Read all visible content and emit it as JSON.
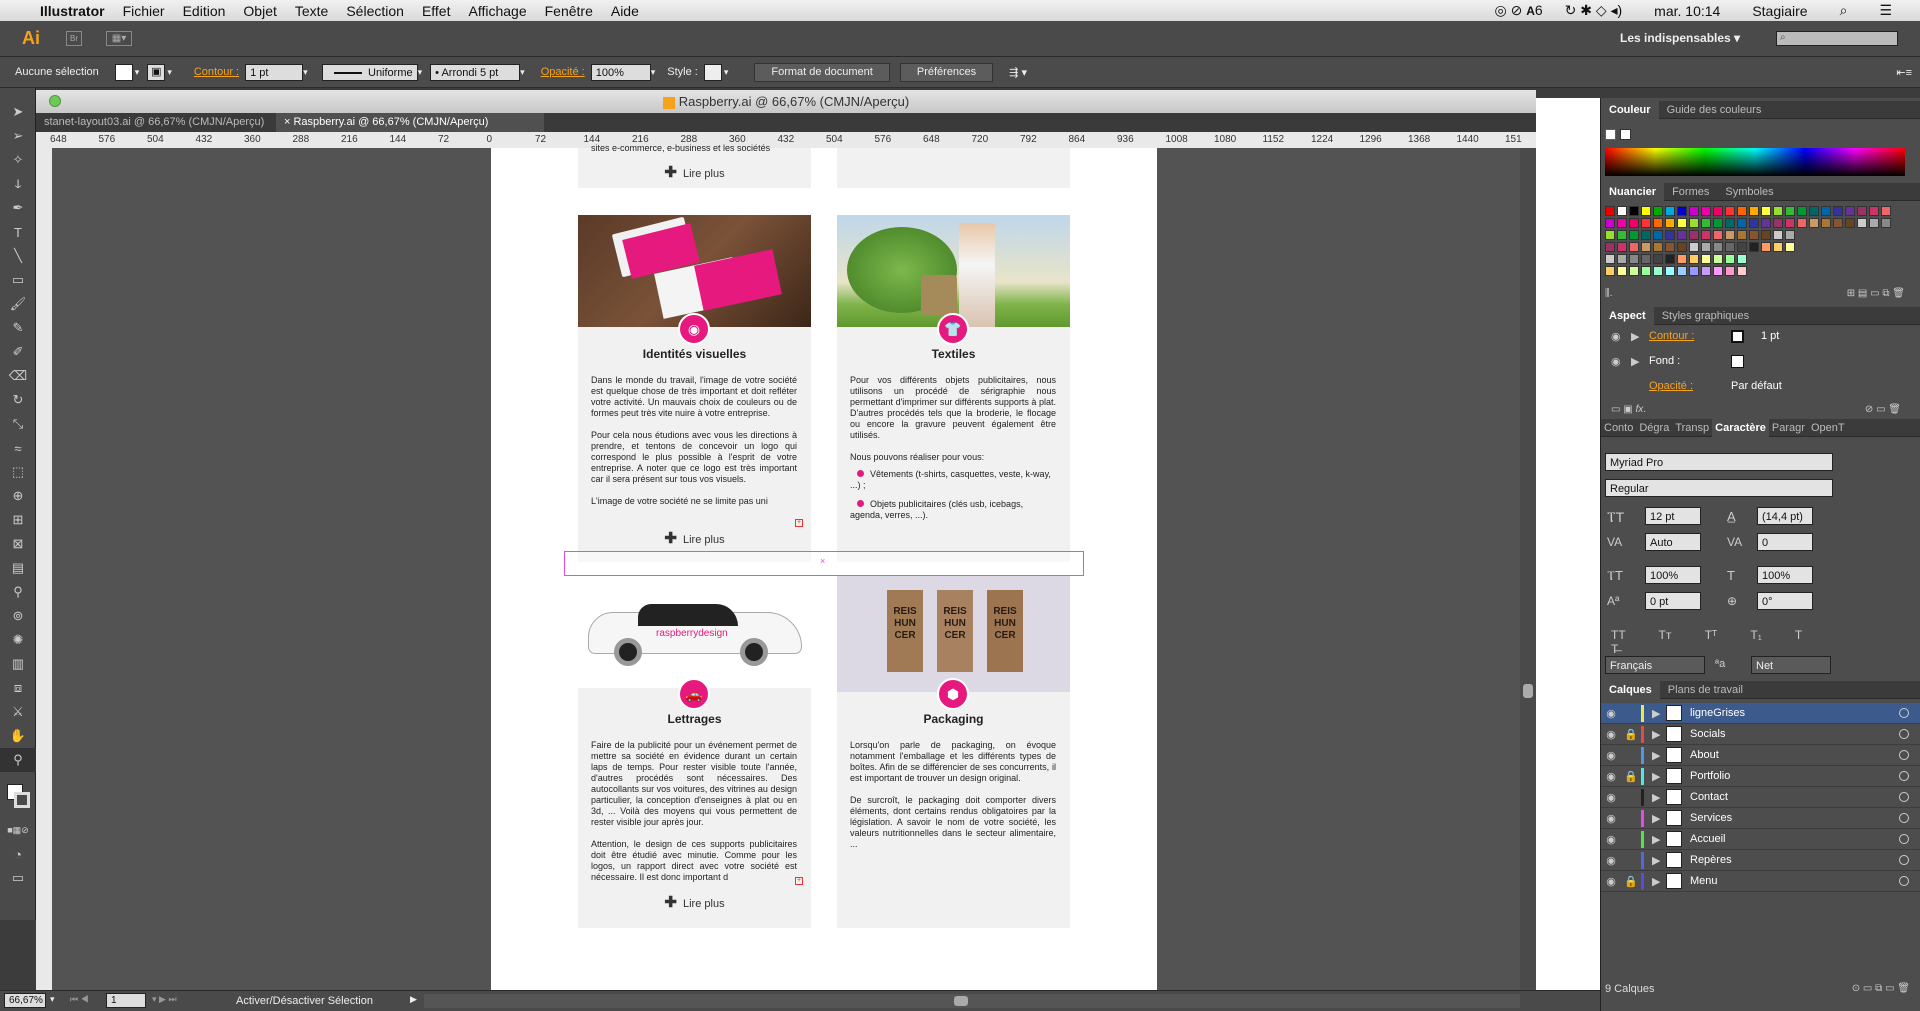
{
  "menubar": {
    "app": "Illustrator",
    "items": [
      "Fichier",
      "Edition",
      "Objet",
      "Texte",
      "Sélection",
      "Effet",
      "Affichage",
      "Fenêtre",
      "Aide"
    ],
    "ai_count": "6",
    "clock": "mar. 10:14",
    "user": "Stagiaire"
  },
  "appbar": {
    "logo": "Ai",
    "workspace": "Les indispensables"
  },
  "control": {
    "selection": "Aucune sélection",
    "stroke_label": "Contour :",
    "stroke_value": "1 pt",
    "profile": "Uniforme",
    "brush": "Arrondi 5 pt",
    "opacity_label": "Opacité :",
    "opacity_value": "100%",
    "style_label": "Style :",
    "doc_format": "Format de document",
    "preferences": "Préférences"
  },
  "document": {
    "title": "Raspberry.ai @ 66,67% (CMJN/Aperçu)",
    "tabs": [
      "stanet-layout03.ai @ 66,67% (CMJN/Aperçu)",
      "Raspberry.ai @ 66,67% (CMJN/Aperçu)"
    ],
    "ruler": [
      "648",
      "576",
      "504",
      "432",
      "360",
      "288",
      "216",
      "144",
      "72",
      "0",
      "72",
      "144",
      "216",
      "288",
      "360",
      "432",
      "504",
      "576",
      "648",
      "720",
      "792",
      "864",
      "936",
      "1008",
      "1080",
      "1152",
      "1224",
      "1296",
      "1368",
      "1440",
      "151"
    ]
  },
  "cards": {
    "top_left_text": "sites e-commerce, e-business et les sociétés",
    "read_more": "Lire plus",
    "identites": {
      "title": "Identités visuelles",
      "body": "Dans le monde du travail, l'image de votre société est quelque chose de très important et doit refléter votre activité. Un mauvais choix de couleurs ou de formes peut très vite nuire à votre entreprise.\n\nPour cela nous étudions avec vous les directions à prendre, et tentons de concevoir un logo qui correspond le plus possible à l'esprit de votre entreprise. A noter que ce logo est très important car il sera présent sur tous vos visuels.\n\nL'image de votre société ne se limite pas uni"
    },
    "textiles": {
      "title": "Textiles",
      "body": "Pour vos différents objets publicitaires, nous utilisons un procédé de sérigraphie nous permettant d'imprimer sur différents supports à plat. D'autres procédés tels que la broderie, le flocage ou encore la gravure peuvent également être utilisés.\n\nNous pouvons réaliser pour vous:",
      "bullets": [
        "Vêtements (t-shirts, casquettes, veste, k-way, ...) ;",
        "Objets publicitaires (clés usb, icebags, agenda, verres, ...)."
      ]
    },
    "lettrages": {
      "title": "Lettrages",
      "car_brand": "raspberrydesign",
      "body": "Faire de la publicité pour un événement permet de mettre sa société en évidence durant un certain laps de temps. Pour rester visible toute l'année, d'autres procédés sont nécessaires. Des autocollants sur vos voitures, des vitrines au design particulier, la conception d'enseignes à plat ou en 3d, ... Voilà des moyens qui vous permettent de rester visible jour après jour.\n\nAttention, le design de ces supports publicitaires doit être étudié avec minutie. Comme pour les logos, un rapport direct avec votre société est nécessaire. Il est donc important d"
    },
    "packaging": {
      "title": "Packaging",
      "bag_text": "REIS HUN CER",
      "body": "Lorsqu'on parle de packaging, on évoque notamment l'emballage et les différents types de boîtes. Afin de se différencier de ses concurrents, il est important de trouver un design original.\n\nDe surcroît, le packaging doit comporter divers éléments, dont certains rendus obligatoires par la législation. A savoir le nom de votre société, les valeurs nutritionnelles dans le secteur alimentaire, ..."
    }
  },
  "panels": {
    "color_tabs": [
      "Couleur",
      "Guide des couleurs"
    ],
    "swatch_tabs": [
      "Nuancier",
      "Formes",
      "Symboles"
    ],
    "aspect_tabs": [
      "Aspect",
      "Styles graphiques"
    ],
    "aspect": {
      "contour": "Contour :",
      "contour_value": "1 pt",
      "fond": "Fond :",
      "opacite": "Opacité :",
      "opacite_value": "Par défaut"
    },
    "char_tabs": [
      "Conto",
      "Dégra",
      "Transp",
      "Caractère",
      "Paragr",
      "OpenT"
    ],
    "character": {
      "font": "Myriad Pro",
      "style": "Regular",
      "size": "12 pt",
      "leading": "(14,4 pt)",
      "kerning": "Auto",
      "tracking": "0",
      "vscale": "100%",
      "hscale": "100%",
      "baseline": "0 pt",
      "rotation": "0°",
      "language": "Français",
      "aa": "Net"
    },
    "layer_tabs": [
      "Calques",
      "Plans de travail"
    ],
    "layers": [
      {
        "name": "ligneGrises",
        "color": "#e8e84a",
        "locked": false
      },
      {
        "name": "Socials",
        "color": "#e84848",
        "locked": true
      },
      {
        "name": "About",
        "color": "#4a9ae8",
        "locked": false
      },
      {
        "name": "Portfolio",
        "color": "#4ae8e8",
        "locked": true
      },
      {
        "name": "Contact",
        "color": "#222222",
        "locked": false
      },
      {
        "name": "Services",
        "color": "#e84ae8",
        "locked": false
      },
      {
        "name": "Accueil",
        "color": "#4ae84a",
        "locked": false
      },
      {
        "name": "Repères",
        "color": "#4a6ae8",
        "locked": false
      },
      {
        "name": "Menu",
        "color": "#5a4ae8",
        "locked": true
      }
    ],
    "layer_count": "9 Calques"
  },
  "status": {
    "zoom": "66,67%",
    "page": "1",
    "info": "Activer/Désactiver Sélection"
  },
  "colors": {
    "accent": "#e5197e",
    "ai_orange": "#f7a21b"
  }
}
